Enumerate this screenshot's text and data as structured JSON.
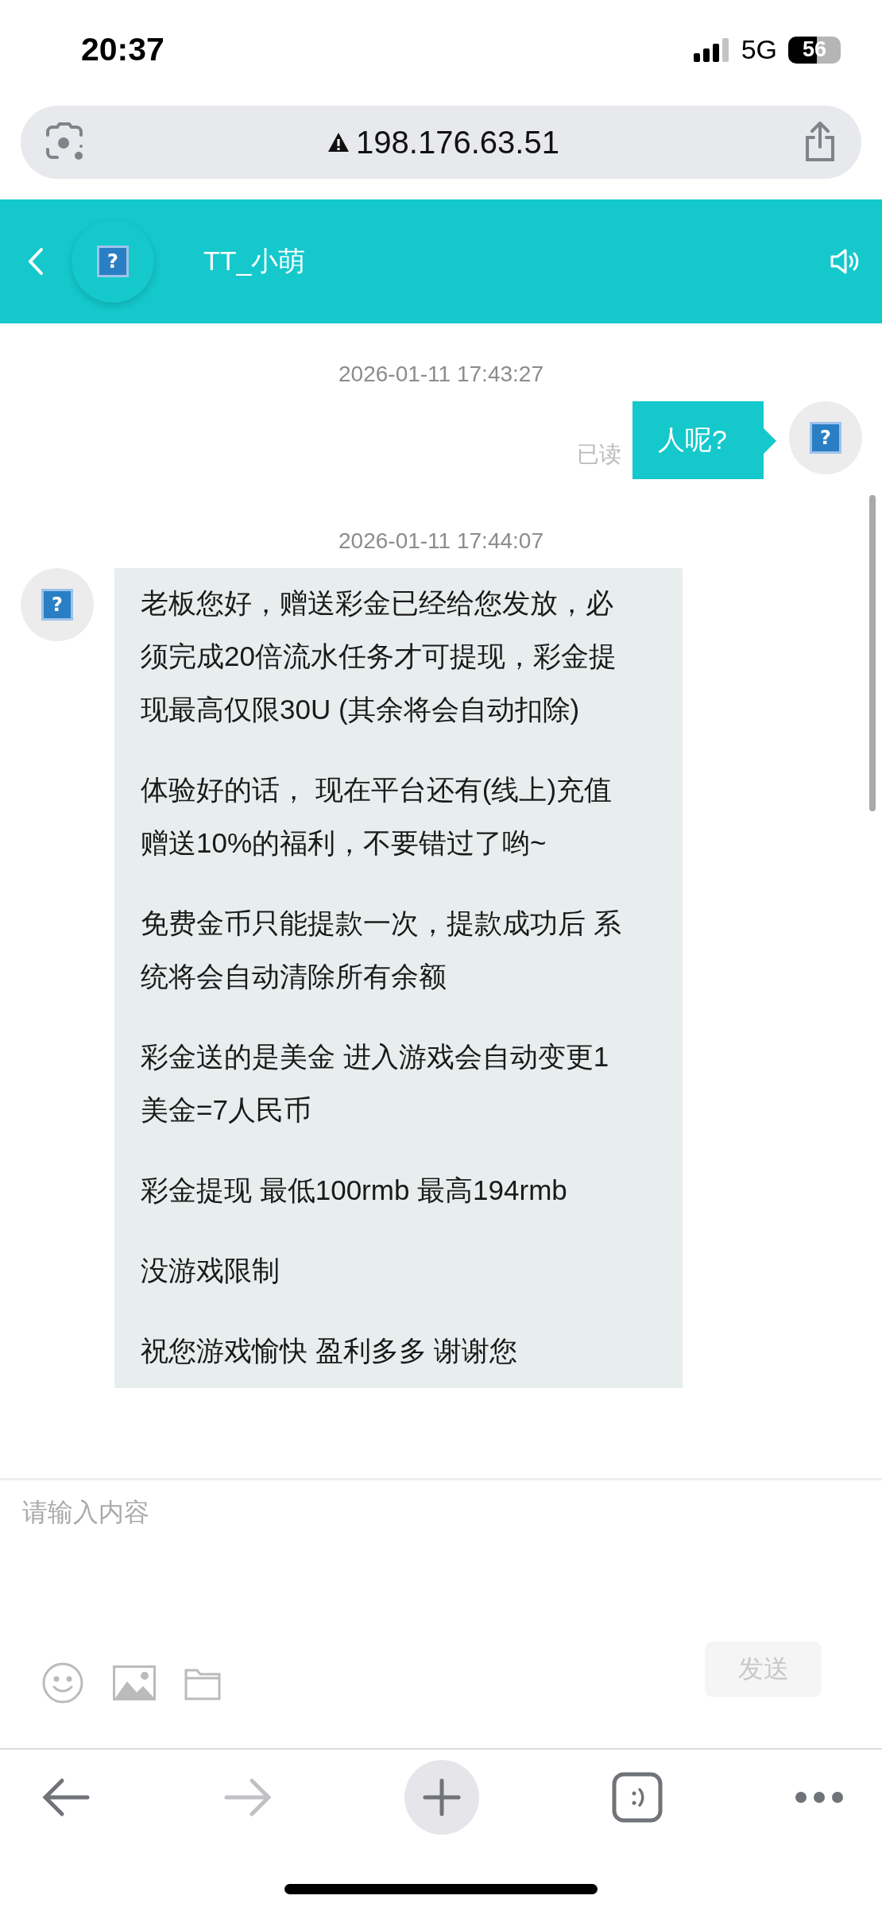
{
  "status_bar": {
    "time": "20:37",
    "network": "5G",
    "battery": "56"
  },
  "address_bar": {
    "url": "198.176.63.51"
  },
  "chat_header": {
    "name": "TT_小萌",
    "avatar_glyph": "?"
  },
  "messages": [
    {
      "kind": "timestamp",
      "text": "2026-01-11 17:43:27"
    },
    {
      "kind": "outgoing",
      "text": "人呢?",
      "status": "已读",
      "avatar_glyph": "?"
    },
    {
      "kind": "timestamp",
      "text": "2026-01-11 17:44:07"
    },
    {
      "kind": "incoming",
      "avatar_glyph": "?",
      "paragraphs": [
        "老板您好，赠送彩金已经给您发放，必须完成20倍流水任务才可提现，彩金提现最高仅限30U (其余将会自动扣除)",
        "体验好的话， 现在平台还有(线上)充值赠送10%的福利，不要错过了哟~",
        "免费金币只能提款一次，提款成功后 系统将会自动清除所有余额",
        "彩金送的是美金 进入游戏会自动变更1美金=7人民币",
        "彩金提现 最低100rmb 最高194rmb",
        "没游戏限制",
        "祝您游戏愉快 盈利多多 谢谢您"
      ]
    }
  ],
  "composer": {
    "placeholder": "请输入内容",
    "send_label": "发送",
    "send_disabled": true
  }
}
